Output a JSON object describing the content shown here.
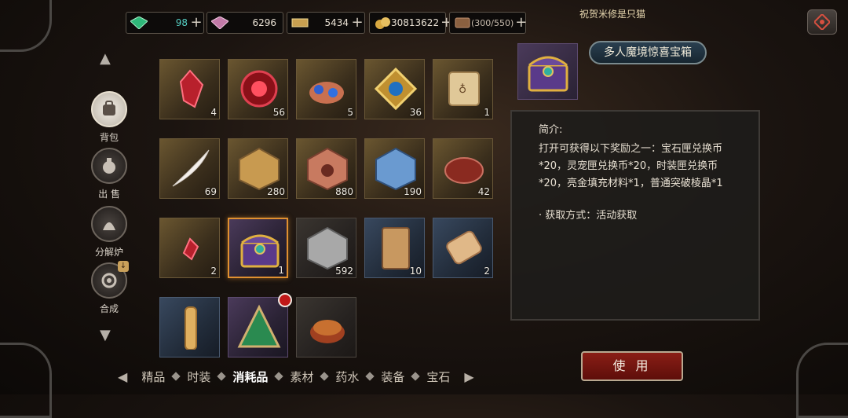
{
  "resources": [
    {
      "name": "emerald",
      "value": "98",
      "value_color": "#4ad0c0"
    },
    {
      "name": "pink-gem",
      "value": "6296"
    },
    {
      "name": "ticket",
      "value": "5434"
    },
    {
      "name": "gold-coins",
      "value": "30813622"
    },
    {
      "name": "bag-capacity",
      "value": "(300/550)"
    }
  ],
  "ticker": "祝贺米修是只猫",
  "nav": {
    "items": [
      {
        "label": "背包"
      },
      {
        "label": "出 售"
      },
      {
        "label": "分解炉"
      },
      {
        "label": "合成"
      }
    ]
  },
  "grid": {
    "slots": [
      {
        "icon": "red-crystal-icon",
        "count": "4",
        "tone": "gold"
      },
      {
        "icon": "red-orb-icon",
        "count": "56",
        "tone": "gold"
      },
      {
        "icon": "claw-gems-icon",
        "count": "5",
        "tone": "gold"
      },
      {
        "icon": "gold-amulet-icon",
        "count": "36",
        "tone": "gold"
      },
      {
        "icon": "scroll-icon",
        "count": "1",
        "tone": "gold"
      },
      {
        "icon": "feather-icon",
        "count": "69",
        "tone": "gold"
      },
      {
        "icon": "gold-emblem-icon",
        "count": "280",
        "tone": "gold"
      },
      {
        "icon": "paw-emblem-icon",
        "count": "880",
        "tone": "gold"
      },
      {
        "icon": "blue-emblem-icon",
        "count": "190",
        "tone": "gold"
      },
      {
        "icon": "meat-icon",
        "count": "42",
        "tone": "gold"
      },
      {
        "icon": "small-red-crystal-icon",
        "count": "2",
        "tone": "gold"
      },
      {
        "icon": "treasure-chest-icon",
        "count": "1",
        "tone": "purple",
        "selected": true
      },
      {
        "icon": "silver-emblem-icon",
        "count": "592",
        "tone": "plain"
      },
      {
        "icon": "parchment-icon",
        "count": "10",
        "tone": "blue"
      },
      {
        "icon": "rolled-scroll-icon",
        "count": "2",
        "tone": "blue"
      },
      {
        "icon": "gold-scroll-icon",
        "count": "",
        "tone": "blue"
      },
      {
        "icon": "pyramid-gem-icon",
        "count": "",
        "tone": "purple",
        "badge": true
      },
      {
        "icon": "food-bowl-icon",
        "count": "",
        "tone": "plain"
      }
    ]
  },
  "detail": {
    "title": "多人魔境惊喜宝箱",
    "heading": "简介:",
    "body": "打开可获得以下奖励之一：宝石匣兑换币*20，灵宠匣兑换币*20，时装匣兑换币*20，亮金填充材料*1，普通突破棱晶*1",
    "source": "· 获取方式：活动获取"
  },
  "use_button": "使 用",
  "tabs": [
    {
      "label": "精品"
    },
    {
      "label": "时装"
    },
    {
      "label": "消耗品",
      "active": true
    },
    {
      "label": "素材"
    },
    {
      "label": "药水"
    },
    {
      "label": "装备"
    },
    {
      "label": "宝石"
    }
  ]
}
